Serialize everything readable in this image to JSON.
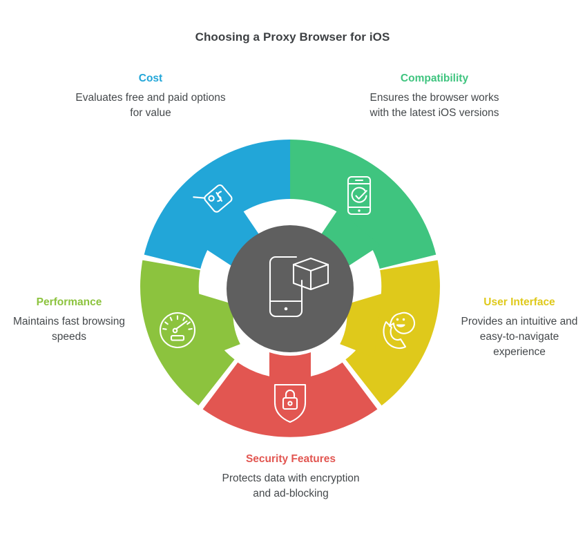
{
  "title": "Choosing a Proxy Browser for iOS",
  "center": {
    "icon": "smartphone-cube-icon",
    "color": "#5F5F5F"
  },
  "colors": {
    "cost": "#22A6D8",
    "compatibility": "#3FC47F",
    "user_interface": "#DFC91B",
    "security": "#E25651",
    "performance": "#8CC33E",
    "center_circle": "#5F5F5F",
    "text": "#44484b",
    "title": "#3d4043"
  },
  "chart_data": {
    "type": "pie",
    "title": "Choosing a Proxy Browser for iOS",
    "legend_position": "around",
    "categories": [
      "Compatibility",
      "User Interface",
      "Security Features",
      "Performance",
      "Cost"
    ],
    "values": [
      20,
      20,
      20,
      20,
      20
    ],
    "colors": [
      "#3FC47F",
      "#DFC91B",
      "#E25651",
      "#8CC33E",
      "#22A6D8"
    ]
  },
  "segments": [
    {
      "key": "cost",
      "heading": "Cost",
      "description": "Evaluates free and paid options for value",
      "color": "#22A6D8",
      "icon": "price-tag-icon"
    },
    {
      "key": "compatibility",
      "heading": "Compatibility",
      "description": "Ensures the browser works with the latest iOS versions",
      "color": "#3FC47F",
      "icon": "phone-check-icon"
    },
    {
      "key": "user_interface",
      "heading": "User Interface",
      "description": "Provides an intuitive and easy-to-navigate experience",
      "color": "#DFC91B",
      "icon": "phone-smiley-chat-icon"
    },
    {
      "key": "security",
      "heading": "Security Features",
      "description": "Protects data with encryption and ad-blocking",
      "color": "#E25651",
      "icon": "shield-lock-icon"
    },
    {
      "key": "performance",
      "heading": "Performance",
      "description": "Maintains fast browsing speeds",
      "color": "#8CC33E",
      "icon": "speedometer-icon"
    }
  ]
}
